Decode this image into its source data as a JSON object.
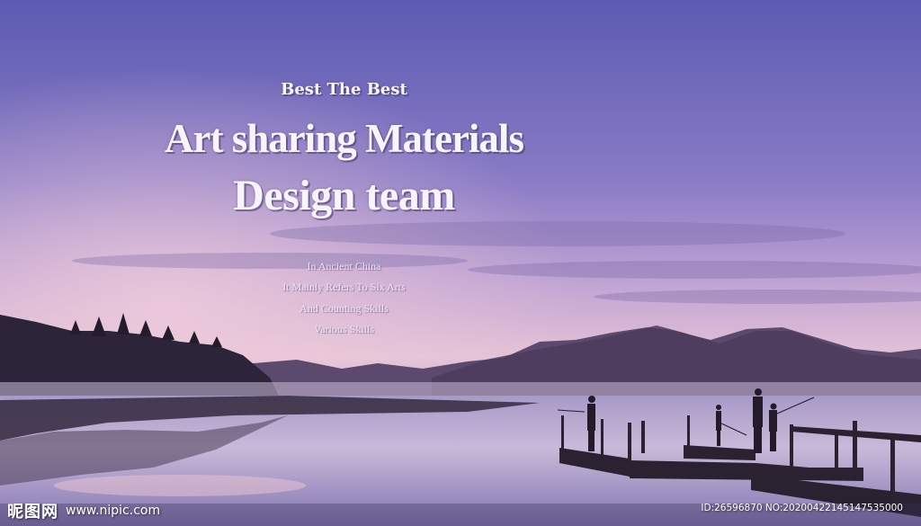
{
  "headline": {
    "kicker": "Best The Best",
    "title_line1": "Art sharing Materials",
    "title_line2": "Design team"
  },
  "subtext": [
    "In Ancient China",
    "It Mainly Refers To Six Arts",
    "And Counting Skills",
    "Various Skills"
  ],
  "watermark": {
    "logo": "昵图网",
    "site": "www.nipic.com",
    "id_text": "ID:26596870 NO:20200422145147535000"
  },
  "colors": {
    "sky_top": "#6260b4",
    "sky_glow": "#e2bfd6",
    "water": "#bfb2d6",
    "mountain": "#3a2f4a"
  }
}
